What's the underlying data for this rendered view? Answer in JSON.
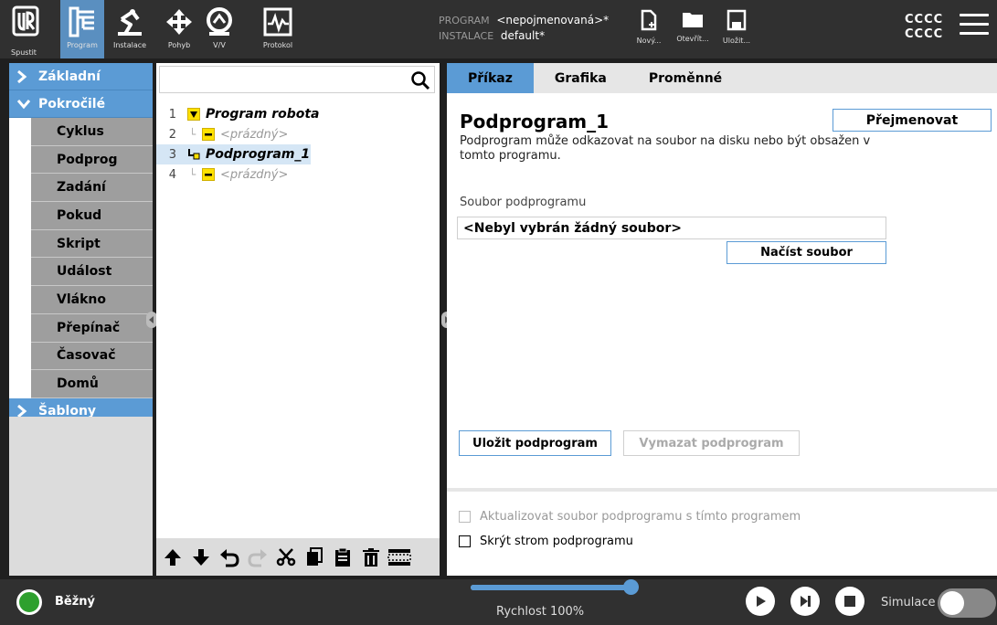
{
  "topbar": {
    "nav": [
      {
        "label": "Spustit",
        "icon": "run-icon"
      },
      {
        "label": "Program",
        "icon": "program-icon",
        "active": true
      },
      {
        "label": "Instalace",
        "icon": "installation-icon"
      },
      {
        "label": "Pohyb",
        "icon": "move-icon"
      },
      {
        "label": "V/V",
        "icon": "io-icon"
      },
      {
        "label": "Protokol",
        "icon": "log-icon"
      }
    ],
    "program_key": "PROGRAM",
    "program_value": "<nepojmenovaná>*",
    "installation_key": "INSTALACE",
    "installation_value": "default*",
    "file_buttons": [
      {
        "label": "Nový...",
        "icon": "new-file-icon"
      },
      {
        "label": "Otevřít...",
        "icon": "folder-icon"
      },
      {
        "label": "Uložit...",
        "icon": "save-icon"
      }
    ],
    "user_line1": "CCCC",
    "user_line2": "CCCC"
  },
  "left_panel": {
    "categories": {
      "basic": "Základní",
      "advanced": "Pokročilé",
      "templates": "Šablony"
    },
    "advanced_items": [
      "Cyklus",
      "Podprog",
      "Zadání",
      "Pokud",
      "Skript",
      "Událost",
      "Vlákno",
      "Přepínač",
      "Časovač",
      "Domů"
    ]
  },
  "tree": {
    "rows": [
      {
        "num": "1",
        "text": "Program robota"
      },
      {
        "num": "2",
        "text": "<prázdný>"
      },
      {
        "num": "3",
        "text": "Podprogram_1"
      },
      {
        "num": "4",
        "text": "<prázdný>"
      }
    ]
  },
  "right_panel": {
    "tabs": [
      "Příkaz",
      "Grafika",
      "Proměnné"
    ],
    "title": "Podprogram_1",
    "rename_label": "Přejmenovat",
    "description": "Podprogram může odkazovat na soubor na disku nebo být obsažen v tomto programu.",
    "file_label": "Soubor podprogramu",
    "file_value": "<Nebyl vybrán žádný soubor>",
    "load_label": "Načíst soubor",
    "save_label": "Uložit podprogram",
    "clear_label": "Vymazat podprogram",
    "update_checkbox": "Aktualizovat soubor podprogramu s tímto programem",
    "hide_checkbox": "Skrýt strom podprogramu"
  },
  "bottombar": {
    "status": "Běžný",
    "status_color": "#2ea02e",
    "speed_label": "Rychlost 100%",
    "speed_fraction": 1.0,
    "simulation_label": "Simulace"
  },
  "colors": {
    "accent": "#5b9bd5",
    "highlight": "#ffe100",
    "dark": "#303030"
  }
}
